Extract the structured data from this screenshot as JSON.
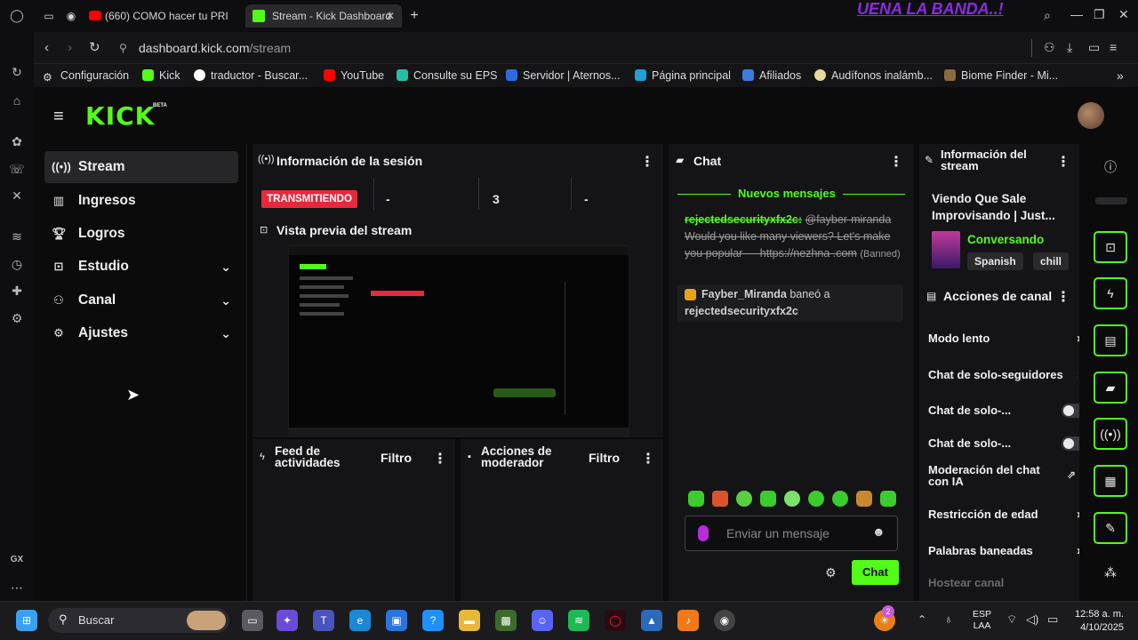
{
  "browser": {
    "tabs": [
      {
        "label": "(660) COMO hacer tu PRI"
      },
      {
        "label": "Stream - Kick Dashboard"
      }
    ],
    "new_tab": "+",
    "overlay_text": "UENA LA BANDA..!",
    "url_domain": "dashboard.kick.com",
    "url_path": "/stream",
    "bookmarks": [
      "Configuración",
      "Kick",
      "traductor - Buscar...",
      "YouTube",
      "Consulte su EPS",
      "Servidor | Aternos...",
      "Página principal",
      "Afiliados",
      "Audífonos inalámb...",
      "Biome Finder - Mi..."
    ],
    "rail_label": "GX"
  },
  "kick": {
    "logo": "KICK",
    "logo_badge": "BETA",
    "nav": [
      {
        "label": "Stream",
        "icon": "broadcast-icon"
      },
      {
        "label": "Ingresos",
        "icon": "chart-icon"
      },
      {
        "label": "Logros",
        "icon": "trophy-icon"
      },
      {
        "label": "Estudio",
        "icon": "studio-icon"
      },
      {
        "label": "Canal",
        "icon": "users-icon"
      },
      {
        "label": "Ajustes",
        "icon": "gear-icon"
      }
    ],
    "session": {
      "title": "Información de la sesión",
      "status": "TRANSMITIENDO",
      "stats": [
        "-",
        "3",
        "-"
      ]
    },
    "preview": {
      "title": "Vista previa del stream"
    },
    "feed": {
      "title": "Feed de actividades",
      "filter": "Filtro"
    },
    "mod": {
      "title": "Acciones de moderador",
      "filter": "Filtro"
    },
    "chat": {
      "title": "Chat",
      "new_messages": "Nuevos mensajes",
      "msg1_user": "rejectedsecurityxfx2c:",
      "msg1_mention": "@fayber-miranda",
      "msg1_text": "Would you like many viewers? Let's make you popular — https://nezhna .com",
      "msg1_banned": "(Banned)",
      "msg2_user": "Fayber_Miranda",
      "msg2_action": "baneó a",
      "msg2_target": "rejectedsecurityxfx2c",
      "placeholder": "Enviar un mensaje",
      "send": "Chat"
    },
    "stream_info": {
      "title": "Información del stream",
      "stream_title": "Viendo Que Sale Improvisando | Just...",
      "category": "Conversando",
      "tags": [
        "Spanish",
        "chill"
      ]
    },
    "channel_actions": {
      "title": "Acciones de canal",
      "items": [
        {
          "label": "Modo lento"
        },
        {
          "label": "Chat de solo-seguidores"
        },
        {
          "label": "Chat de solo-..."
        },
        {
          "label": "Chat de solo-..."
        },
        {
          "label": "Moderación del chat con IA"
        },
        {
          "label": "Restricción de edad"
        },
        {
          "label": "Palabras baneadas"
        },
        {
          "label": "Hostear canal"
        }
      ]
    }
  },
  "taskbar": {
    "search": "Buscar",
    "lang1": "ESP",
    "lang2": "LAA",
    "time": "12:58 a. m.",
    "date": "4/10/2025",
    "notif_count": "2"
  },
  "colors": {
    "accent": "#53fc18",
    "status": "#e8283d"
  }
}
